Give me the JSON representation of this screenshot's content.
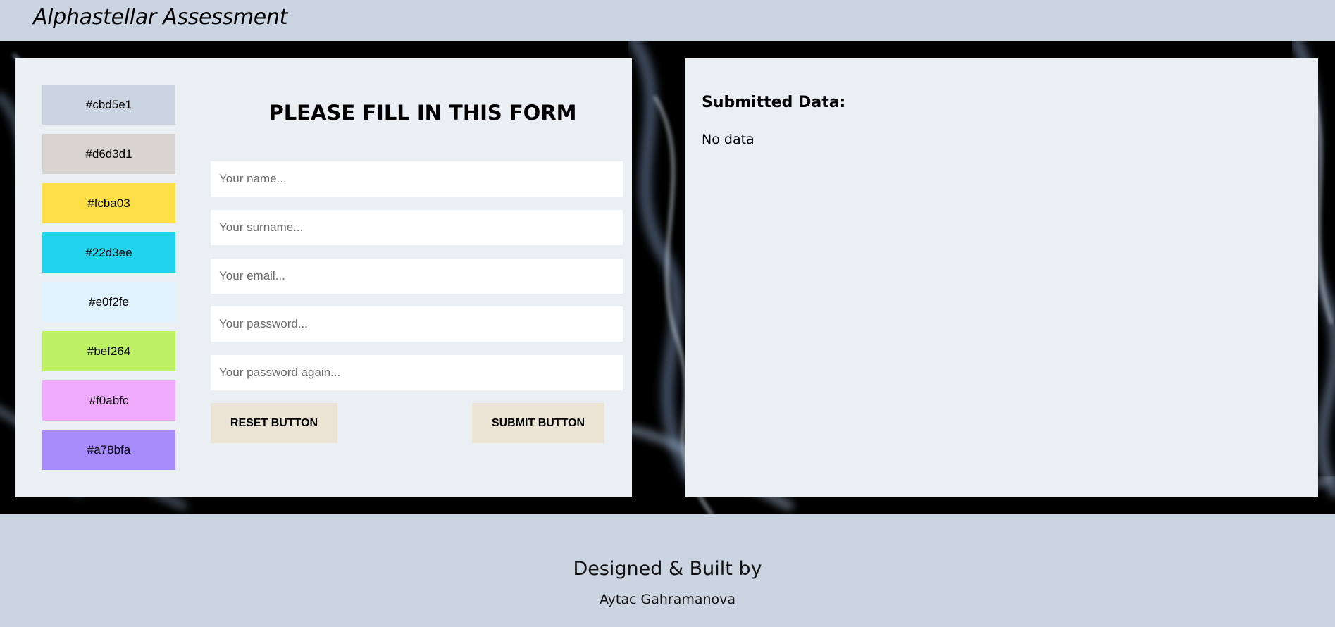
{
  "header": {
    "title": "Alphastellar Assessment"
  },
  "palette": [
    {
      "label": "#cbd5e1",
      "color": "#cbd5e1"
    },
    {
      "label": "#d6d3d1",
      "color": "#d6d3d1"
    },
    {
      "label": "#fcba03",
      "color": "#fde047"
    },
    {
      "label": "#22d3ee",
      "color": "#22d3ee"
    },
    {
      "label": "#e0f2fe",
      "color": "#e0f2fe"
    },
    {
      "label": "#bef264",
      "color": "#bef264"
    },
    {
      "label": "#f0abfc",
      "color": "#f0abfc"
    },
    {
      "label": "#a78bfa",
      "color": "#a78bfa"
    }
  ],
  "form": {
    "title": "PLEASE FILL IN THIS FORM",
    "name_placeholder": "Your name...",
    "surname_placeholder": "Your surname...",
    "email_placeholder": "Your email...",
    "password_placeholder": "Your password...",
    "password_again_placeholder": "Your password again...",
    "name_value": "",
    "surname_value": "",
    "email_value": "",
    "password_value": "",
    "password_again_value": "",
    "reset_label": "RESET BUTTON",
    "submit_label": "SUBMIT BUTTON"
  },
  "submitted": {
    "heading": "Submitted Data:",
    "body": "No data"
  },
  "footer": {
    "line1": "Designed & Built by",
    "line2": "Aytac Gahramanova"
  },
  "colors": {
    "header_bg": "#cbd5e1",
    "panel_bg": "#eaeff4",
    "button_bg": "#ebe4d5"
  }
}
